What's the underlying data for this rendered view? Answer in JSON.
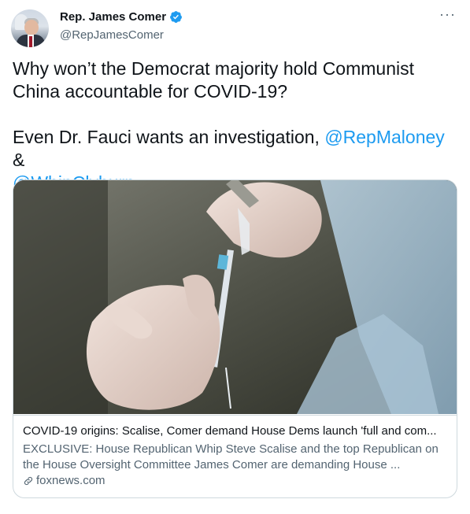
{
  "author": {
    "display_name": "Rep. James Comer",
    "handle": "@RepJamesComer"
  },
  "tweet": {
    "line1": "Why won’t the Democrat majority hold Communist China accountable for COVID-19?",
    "line2_prefix": "Even Dr. Fauci wants an investigation, ",
    "mention1": "@RepMaloney",
    "line2_joiner": " &",
    "mention2": "@WhipClyburn"
  },
  "card": {
    "title": "COVID-19 origins: Scalise, Comer demand House Dems launch 'full and com...",
    "description": "EXCLUSIVE: House Republican Whip Steve Scalise and the top Republican on the House Oversight Committee James Comer are demanding House ...",
    "domain": "foxnews.com"
  },
  "more_label": "···",
  "colors": {
    "link": "#1d9bf0",
    "verified": "#1d9bf0",
    "secondary_text": "#536471",
    "border": "#cfd9de"
  },
  "icons": [
    "verified-badge-icon",
    "more-options-icon",
    "link-icon"
  ]
}
